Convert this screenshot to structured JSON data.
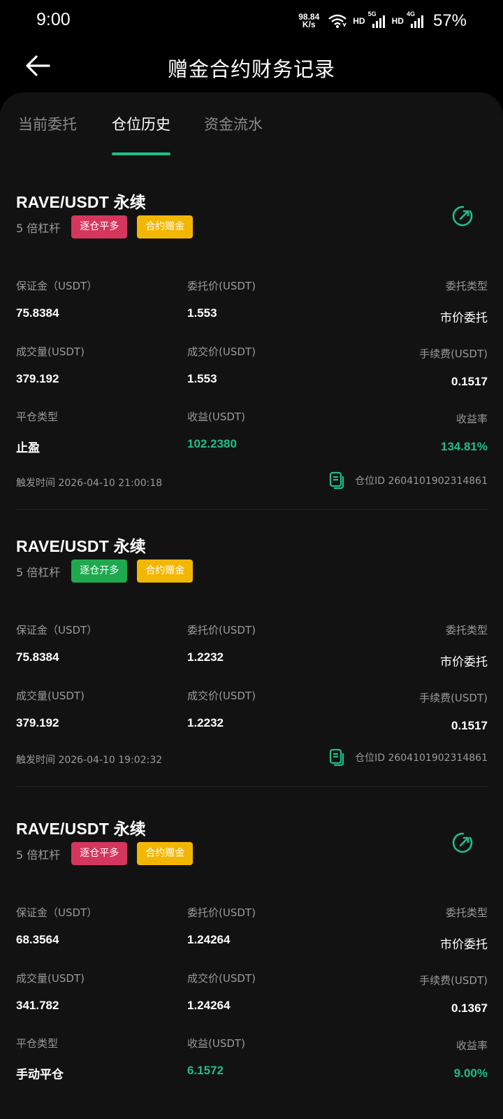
{
  "status": {
    "time": "9:00",
    "net_speed_value": "98.84",
    "net_speed_unit": "K/s",
    "hd1": "HD",
    "gen1": "5G",
    "hd2": "HD",
    "gen2": "4G",
    "battery": "57%"
  },
  "nav": {
    "title": "赠金合约财务记录"
  },
  "tabs": [
    {
      "label": "当前委托"
    },
    {
      "label": "仓位历史"
    },
    {
      "label": "资金流水"
    }
  ],
  "cards": [
    {
      "title": "RAVE/USDT 永续",
      "leverage": "5 倍杠杆",
      "tag1": "逐仓平多",
      "tag2": "合约赠金",
      "margin_label": "保证金（USDT）",
      "margin_value": "75.8384",
      "order_price_label": "委托价(USDT)",
      "order_price_value": "1.553",
      "order_type_label": "委托类型",
      "order_type_value": "市价委托",
      "volume_label": "成交量(USDT)",
      "volume_value": "379.192",
      "deal_price_label": "成交价(USDT)",
      "deal_price_value": "1.553",
      "fee_label": "手续费(USDT)",
      "fee_value": "0.1517",
      "close_type_label": "平仓类型",
      "close_type_value": "止盈",
      "pnl_label": "收益(USDT)",
      "pnl_value": "102.2380",
      "roi_label": "收益率",
      "roi_value": "134.81%",
      "trigger_time": "触发时间 2026-04-10 21:00:18",
      "position_id": "仓位ID 2604101902314861"
    },
    {
      "title": "RAVE/USDT 永续",
      "leverage": "5 倍杠杆",
      "tag1": "逐仓开多",
      "tag2": "合约赠金",
      "margin_label": "保证金（USDT）",
      "margin_value": "75.8384",
      "order_price_label": "委托价(USDT)",
      "order_price_value": "1.2232",
      "order_type_label": "委托类型",
      "order_type_value": "市价委托",
      "volume_label": "成交量(USDT)",
      "volume_value": "379.192",
      "deal_price_label": "成交价(USDT)",
      "deal_price_value": "1.2232",
      "fee_label": "手续费(USDT)",
      "fee_value": "0.1517",
      "trigger_time": "触发时间 2026-04-10 19:02:32",
      "position_id": "仓位ID 2604101902314861"
    },
    {
      "title": "RAVE/USDT 永续",
      "leverage": "5 倍杠杆",
      "tag1": "逐仓平多",
      "tag2": "合约赠金",
      "margin_label": "保证金（USDT）",
      "margin_value": "68.3564",
      "order_price_label": "委托价(USDT)",
      "order_price_value": "1.24264",
      "order_type_label": "委托类型",
      "order_type_value": "市价委托",
      "volume_label": "成交量(USDT)",
      "volume_value": "341.782",
      "deal_price_label": "成交价(USDT)",
      "deal_price_value": "1.24264",
      "fee_label": "手续费(USDT)",
      "fee_value": "0.1367",
      "close_type_label": "平仓类型",
      "close_type_value": "手动平仓",
      "pnl_label": "收益(USDT)",
      "pnl_value": "6.1572",
      "roi_label": "收益率",
      "roi_value": "9.00%"
    }
  ],
  "colors": {
    "accent": "#1fbf87",
    "red_tag": "#d5365d",
    "green_tag": "#1fa94e",
    "yellow_tag": "#f2b705",
    "bg": "#121212"
  }
}
